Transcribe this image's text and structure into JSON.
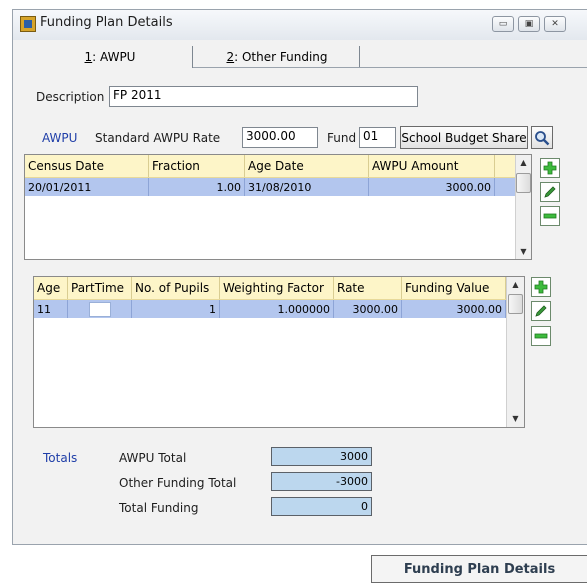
{
  "window": {
    "title": "Funding Plan Details",
    "icon": "funding-plan-icon"
  },
  "window_buttons": {
    "minimize": "▭",
    "maximize": "▣",
    "close": "✕"
  },
  "tabs": [
    {
      "key": "1",
      "label": ": AWPU",
      "active": true
    },
    {
      "key": "2",
      "label": ": Other Funding",
      "active": false
    }
  ],
  "form": {
    "description_label": "Description",
    "description_value": "FP 2011",
    "awpu_label": "AWPU",
    "standard_rate_label": "Standard AWPU Rate",
    "standard_rate_value": "3000.00",
    "fund_label": "Fund",
    "fund_value": "01",
    "school_budget_share_button": "School Budget Share"
  },
  "census_grid": {
    "columns": [
      "Census Date",
      "Fraction",
      "Age Date",
      "AWPU Amount"
    ],
    "rows": [
      {
        "census_date": "20/01/2011",
        "fraction": "1.00",
        "age_date": "31/08/2010",
        "awpu_amount": "3000.00"
      }
    ]
  },
  "age_grid": {
    "columns": [
      "Age",
      "PartTime",
      "No. of Pupils",
      "Weighting Factor",
      "Rate",
      "Funding Value"
    ],
    "rows": [
      {
        "age": "11",
        "parttime": false,
        "pupils": "1",
        "weighting": "1.000000",
        "rate": "3000.00",
        "funding_value": "3000.00"
      }
    ]
  },
  "totals": {
    "label": "Totals",
    "awpu_total_label": "AWPU Total",
    "awpu_total_value": "3000",
    "other_funding_label": "Other Funding Total",
    "other_funding_value": "-3000",
    "total_funding_label": "Total Funding",
    "total_funding_value": "0"
  },
  "footer": {
    "caption": "Funding Plan Details"
  },
  "colors": {
    "accent_blue": "#1f3ea8",
    "header_yellow": "#fdf5c8",
    "selection": "#b3c6ee",
    "total_bg": "#bcd7ee"
  }
}
